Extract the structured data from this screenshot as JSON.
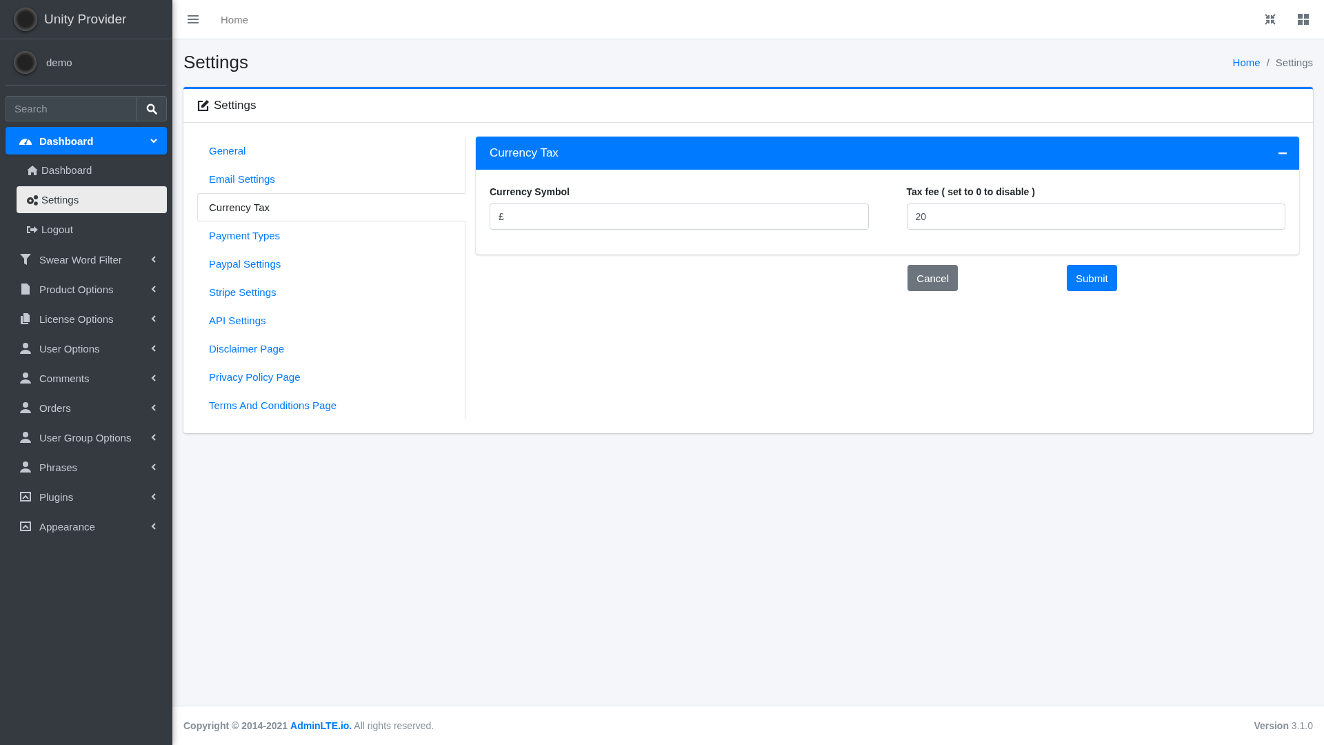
{
  "brand": {
    "name": "Unity Provider"
  },
  "user": {
    "name": "demo"
  },
  "sidebar_search": {
    "placeholder": "Search"
  },
  "sidebar": {
    "items": [
      {
        "label": "Dashboard",
        "selected": true,
        "expanded": true,
        "children": [
          {
            "label": "Dashboard",
            "selected": false
          },
          {
            "label": "Settings",
            "selected": true
          },
          {
            "label": "Logout",
            "selected": false
          }
        ]
      },
      {
        "label": "Swear Word Filter",
        "selected": false,
        "expanded": false
      },
      {
        "label": "Product Options",
        "selected": false,
        "expanded": false
      },
      {
        "label": "License Options",
        "selected": false,
        "expanded": false
      },
      {
        "label": "User Options",
        "selected": false,
        "expanded": false
      },
      {
        "label": "Comments",
        "selected": false,
        "expanded": false
      },
      {
        "label": "Orders",
        "selected": false,
        "expanded": false
      },
      {
        "label": "User Group Options",
        "selected": false,
        "expanded": false
      },
      {
        "label": "Phrases",
        "selected": false,
        "expanded": false
      },
      {
        "label": "Plugins",
        "selected": false,
        "expanded": false
      },
      {
        "label": "Appearance",
        "selected": false,
        "expanded": false
      }
    ]
  },
  "topbar": {
    "links": [
      "Home"
    ]
  },
  "page": {
    "title": "Settings",
    "breadcrumb": [
      {
        "label": "Home",
        "link": true
      },
      {
        "label": "Settings",
        "link": false
      }
    ],
    "breadcrumb_separator": "/"
  },
  "card": {
    "title": "Settings",
    "menu": [
      {
        "label": "General",
        "selected": false
      },
      {
        "label": "Email Settings",
        "selected": false
      },
      {
        "label": "Currency Tax",
        "selected": true
      },
      {
        "label": "Payment Types",
        "selected": false
      },
      {
        "label": "Paypal Settings",
        "selected": false
      },
      {
        "label": "Stripe Settings",
        "selected": false
      },
      {
        "label": "API Settings",
        "selected": false
      },
      {
        "label": "Disclaimer Page",
        "selected": false
      },
      {
        "label": "Privacy Policy Page",
        "selected": false
      },
      {
        "label": "Terms And Conditions Page",
        "selected": false
      }
    ],
    "panel": {
      "title": "Currency Tax",
      "fields": [
        {
          "label": "Currency Symbol",
          "value": "£"
        },
        {
          "label": "Tax fee ( set to 0 to disable )",
          "value": "20"
        }
      ],
      "buttons": [
        {
          "label": "Cancel",
          "kind": "secondary"
        },
        {
          "label": "Submit",
          "kind": "primary"
        }
      ]
    }
  },
  "footer": {
    "prefix": "Copyright © 2014-2021",
    "link": "AdminLTE.io.",
    "suffix": "All rights reserved.",
    "version_label": "Version",
    "version": "3.1.0"
  }
}
